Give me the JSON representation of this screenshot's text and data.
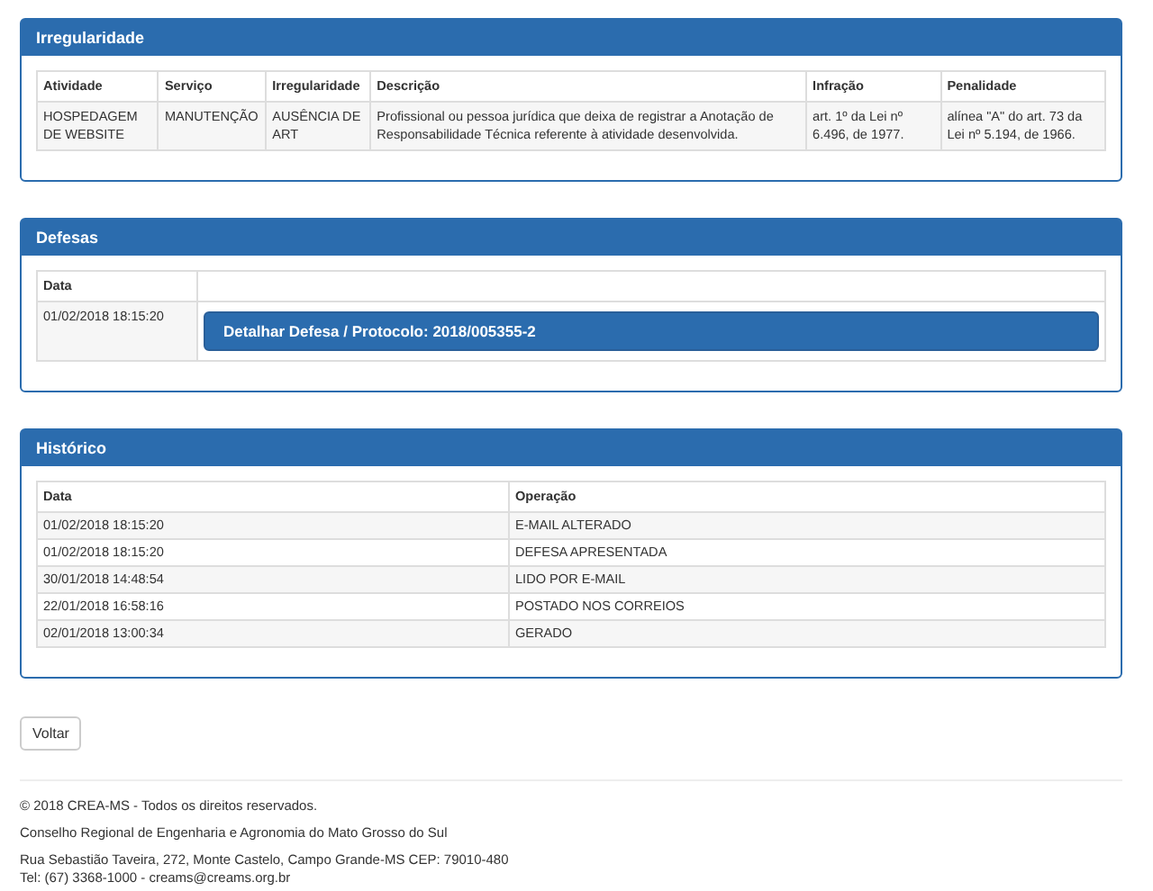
{
  "irregularidade": {
    "title": "Irregularidade",
    "columns": [
      "Atividade",
      "Serviço",
      "Irregularidade",
      "Descrição",
      "Infração",
      "Penalidade"
    ],
    "rows": [
      [
        "HOSPEDAGEM DE WEBSITE",
        "MANUTENÇÃO",
        "AUSÊNCIA DE ART",
        "Profissional ou pessoa jurídica que deixa de registrar a Anotação de Responsabilidade Técnica referente à atividade desenvolvida.",
        "art. 1º da Lei nº 6.496, de 1977.",
        "alínea \"A\" do art. 73 da Lei nº 5.194, de 1966."
      ]
    ]
  },
  "defesas": {
    "title": "Defesas",
    "columns": [
      "Data"
    ],
    "rows": [
      {
        "date": "01/02/2018 18:15:20",
        "button": "Detalhar Defesa / Protocolo: 2018/005355-2"
      }
    ]
  },
  "historico": {
    "title": "Histórico",
    "columns": [
      "Data",
      "Operação"
    ],
    "rows": [
      [
        "01/02/2018 18:15:20",
        "E-MAIL ALTERADO"
      ],
      [
        "01/02/2018 18:15:20",
        "DEFESA APRESENTADA"
      ],
      [
        "30/01/2018 14:48:54",
        "LIDO POR E-MAIL"
      ],
      [
        "22/01/2018 16:58:16",
        "POSTADO NOS CORREIOS"
      ],
      [
        "02/01/2018 13:00:34",
        "GERADO"
      ]
    ]
  },
  "back_button": "Voltar",
  "footer": {
    "lines": [
      "© 2018 CREA-MS - Todos os direitos reservados.",
      "Conselho Regional de Engenharia e Agronomia do Mato Grosso do Sul"
    ],
    "address": "Rua Sebastião Taveira, 272, Monte Castelo, Campo Grande-MS CEP: 79010-480",
    "contact": "Tel: (67) 3368-1000 - creams@creams.org.br"
  }
}
